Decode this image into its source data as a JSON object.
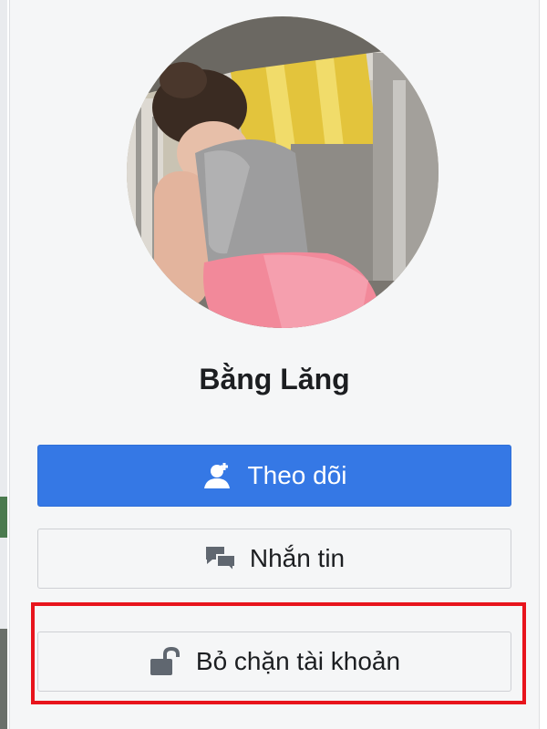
{
  "profile": {
    "name": "Bằng Lăng"
  },
  "actions": {
    "follow_label": "Theo dõi",
    "message_label": "Nhắn tin",
    "unblock_label": "Bỏ chặn tài khoản"
  },
  "icons": {
    "follow": "add-friend-icon",
    "message": "chat-bubbles-icon",
    "unblock": "unlocked-padlock-icon"
  },
  "colors": {
    "follow_button_bg": "#3578e5",
    "highlight_border": "#e8141c",
    "card_bg": "#f5f6f7"
  }
}
